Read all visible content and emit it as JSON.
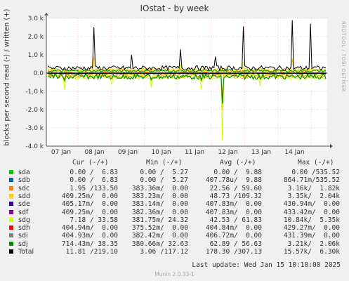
{
  "title": "IOstat - by week",
  "side_label": "RRDTOOL / TOBI OETIKER",
  "chart_data": {
    "type": "line",
    "title": "IOstat - by week",
    "ylabel": "blocks per second read (-) / written (+)",
    "ylim": [
      -4000,
      3000
    ],
    "yticks": [
      "3.0 k",
      "2.0 k",
      "1.0 k",
      "0.0",
      "-1.0 k",
      "-2.0 k",
      "-3.0 k",
      "-4.0 k"
    ],
    "ytick_values": [
      3000,
      2000,
      1000,
      0,
      -1000,
      -2000,
      -3000,
      -4000
    ],
    "xticks": [
      "07 Jan",
      "08 Jan",
      "09 Jan",
      "10 Jan",
      "11 Jan",
      "12 Jan",
      "13 Jan",
      "14 Jan"
    ],
    "grid": true,
    "series": [
      {
        "name": "sda",
        "color": "#00cc00"
      },
      {
        "name": "sdb",
        "color": "#0066b3"
      },
      {
        "name": "sdc",
        "color": "#ff8000"
      },
      {
        "name": "sdd",
        "color": "#ffcc00"
      },
      {
        "name": "sde",
        "color": "#330099"
      },
      {
        "name": "sdf",
        "color": "#990099"
      },
      {
        "name": "sdg",
        "color": "#ccff00"
      },
      {
        "name": "sdh",
        "color": "#ff0000"
      },
      {
        "name": "sdi",
        "color": "#808080"
      },
      {
        "name": "sdj",
        "color": "#008f00"
      },
      {
        "name": "Total",
        "color": "#000000"
      }
    ]
  },
  "legend": {
    "headers": [
      "Cur (-/+)",
      "Min (-/+)",
      "Avg (-/+)",
      "Max (-/+)"
    ],
    "rows": [
      {
        "name": "sda",
        "color": "#00cc00",
        "cur": "0.00 /  6.83",
        "min": "0.00 /  5.27",
        "avg": "0.00 /  9.88",
        "max": "0.00 /535.52"
      },
      {
        "name": "sdb",
        "color": "#0066b3",
        "cur": "0.00 /  6.83",
        "min": "0.00 /  5.27",
        "avg": "407.78u/  9.88",
        "max": "864.71m/535.52"
      },
      {
        "name": "sdc",
        "color": "#ff8000",
        "cur": "1.95 /133.50",
        "min": "383.36m/  0.00",
        "avg": "22.56 / 59.60",
        "max": "3.16k/  1.82k"
      },
      {
        "name": "sdd",
        "color": "#ffcc00",
        "cur": "409.25m/  0.00",
        "min": "383.23m/  0.00",
        "avg": "48.73 /109.32",
        "max": "3.35k/  2.04k"
      },
      {
        "name": "sde",
        "color": "#330099",
        "cur": "405.17m/  0.00",
        "min": "383.14m/  0.00",
        "avg": "407.83m/  0.00",
        "max": "430.94m/  0.00"
      },
      {
        "name": "sdf",
        "color": "#990099",
        "cur": "409.25m/  0.00",
        "min": "382.36m/  0.00",
        "avg": "407.83m/  0.00",
        "max": "433.42m/  0.00"
      },
      {
        "name": "sdg",
        "color": "#ccff00",
        "cur": "7.18 / 33.58",
        "min": "381.75m/ 24.32",
        "avg": "42.53 / 61.83",
        "max": "10.84k/  5.35k"
      },
      {
        "name": "sdh",
        "color": "#ff0000",
        "cur": "404.94m/  0.00",
        "min": "375.52m/  0.00",
        "avg": "404.84m/  0.00",
        "max": "429.27m/  0.00"
      },
      {
        "name": "sdi",
        "color": "#808080",
        "cur": "404.93m/  0.00",
        "min": "382.42m/  0.00",
        "avg": "406.72m/  0.00",
        "max": "431.39m/  0.00"
      },
      {
        "name": "sdj",
        "color": "#008f00",
        "cur": "714.43m/ 38.35",
        "min": "380.66m/ 32.63",
        "avg": "62.89 / 56.63",
        "max": "3.21k/  2.06k"
      },
      {
        "name": "Total",
        "color": "#000000",
        "cur": "11.81 /219.10",
        "min": "3.06 /117.12",
        "avg": "178.30 /307.13",
        "max": "15.57k/  6.30k"
      }
    ]
  },
  "last_update": "Last update:  Wed Jan 15 10:10:00 2025",
  "footer": "Munin 2.0.33-1"
}
